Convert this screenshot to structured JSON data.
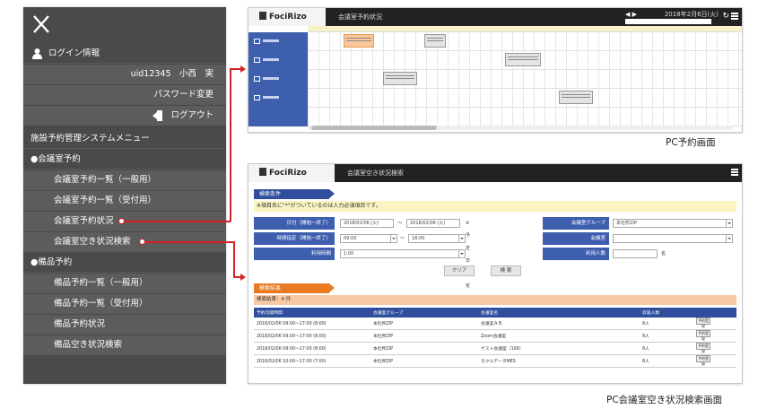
{
  "menu": {
    "login_info": "ログイン情報",
    "user": "uid12345　小西　実",
    "password_change": "パスワード変更",
    "logout": "ログアウト",
    "system_menu": "施設予約管理システムメニュー",
    "section_room": "●会議室予約",
    "room_items": [
      "会議室予約一覧（一般用）",
      "会議室予約一覧（受付用）",
      "会議室予約状況",
      "会議室空き状況検索"
    ],
    "section_equipment": "●備品予約",
    "equipment_items": [
      "備品予約一覧（一般用）",
      "備品予約一覧（受付用）",
      "備品予約状況",
      "備品空き状況検索"
    ]
  },
  "screen1": {
    "logo": "FociRizo",
    "title": "会議室予約状況",
    "date": "2018年2月6日(火)",
    "caption": "PC予約画面"
  },
  "screen2": {
    "logo": "FociRizo",
    "title": "会議室空き状況検索",
    "caption": "PC会議室空き状況検索画面",
    "search_tag": "検索条件",
    "notice": "※項目名に\"*\"がついているのは入力必須項目です。",
    "date_label": "日付（開始～終了）",
    "date_from": "2018/02/06 (火)",
    "date_to": "2018/02/06 (火)",
    "date_note": "※予定日指定",
    "time_label": "時間指定（開始～終了）",
    "time_from": "09:00",
    "time_to": "18:00",
    "usage_label": "利用時間",
    "usage_value": "1:00",
    "group_label": "会議室グループ",
    "group_value": "本社所ZIP",
    "room_label": "会議室",
    "people_label": "利用人数",
    "people_unit": "名",
    "clear_btn": "クリア",
    "search_btn": "検 索",
    "result_tag": "検索結果",
    "result_count": "検索結果：4 件",
    "table_headers": [
      "予約可能時間",
      "会議室グループ",
      "会議室名",
      "収容人数",
      ""
    ],
    "rows": [
      {
        "time": "2018/02/06 09:00～17:00 (8:00)",
        "group": "本社所ZIP",
        "room": "会議室ＡＢ",
        "cap": "8人",
        "action": "予約登録"
      },
      {
        "time": "2018/02/06 09:00～17:00 (8:00)",
        "group": "本社所ZIP",
        "room": "Zoom会議室",
        "cap": "8人",
        "action": "予約登録"
      },
      {
        "time": "2018/02/06 09:00～17:00 (8:00)",
        "group": "本社所ZIP",
        "room": "ゲスト会議室（100）",
        "cap": "8人",
        "action": "予約登録"
      },
      {
        "time": "2018/02/06 10:00～17:00 (7:00)",
        "group": "本社所ZIP",
        "room": "モクルデータMES",
        "cap": "8人",
        "action": "予約登録"
      }
    ]
  },
  "colors": {
    "menu_bg": "#4a4a4a",
    "accent_blue": "#3e5fae",
    "accent_red": "#d81f26",
    "accent_orange": "#e97a1f"
  }
}
